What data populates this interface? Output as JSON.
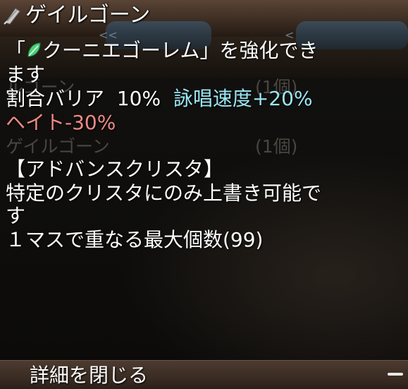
{
  "item": {
    "name": "ゲイルゴーン"
  },
  "tooltip": {
    "line1_prefix": "「",
    "line1_suffix": "クーニエゴーレム」を強化でき",
    "line2": "ます",
    "barrier_label": "割合バリア",
    "barrier_value": "10%",
    "cast_speed": "詠唱速度+20%",
    "hate": "ヘイト-30%",
    "category": "【アドバンスクリスタ】",
    "desc_line1": "特定のクリスタにのみ上書き可能で",
    "desc_line2": "す",
    "stack": "１マスで重なる最大個数(99)"
  },
  "background_list": {
    "row1_name": "ルゴーン",
    "row1_count": "(1個)",
    "row2_name": "ゲイルゴーン",
    "row2_count": "(1個)",
    "chevron_left": "<<",
    "chevron_right": "<"
  },
  "footer": {
    "label": "詳細を閉じる"
  },
  "colors": {
    "cyan_text": "#9be6f2",
    "red_text": "#ef8a83",
    "leaf_icon": "#4fd07a"
  },
  "icons": {
    "title": "crystal-feather-icon",
    "inline": "green-leaf-icon",
    "collapse": "minus-icon"
  }
}
